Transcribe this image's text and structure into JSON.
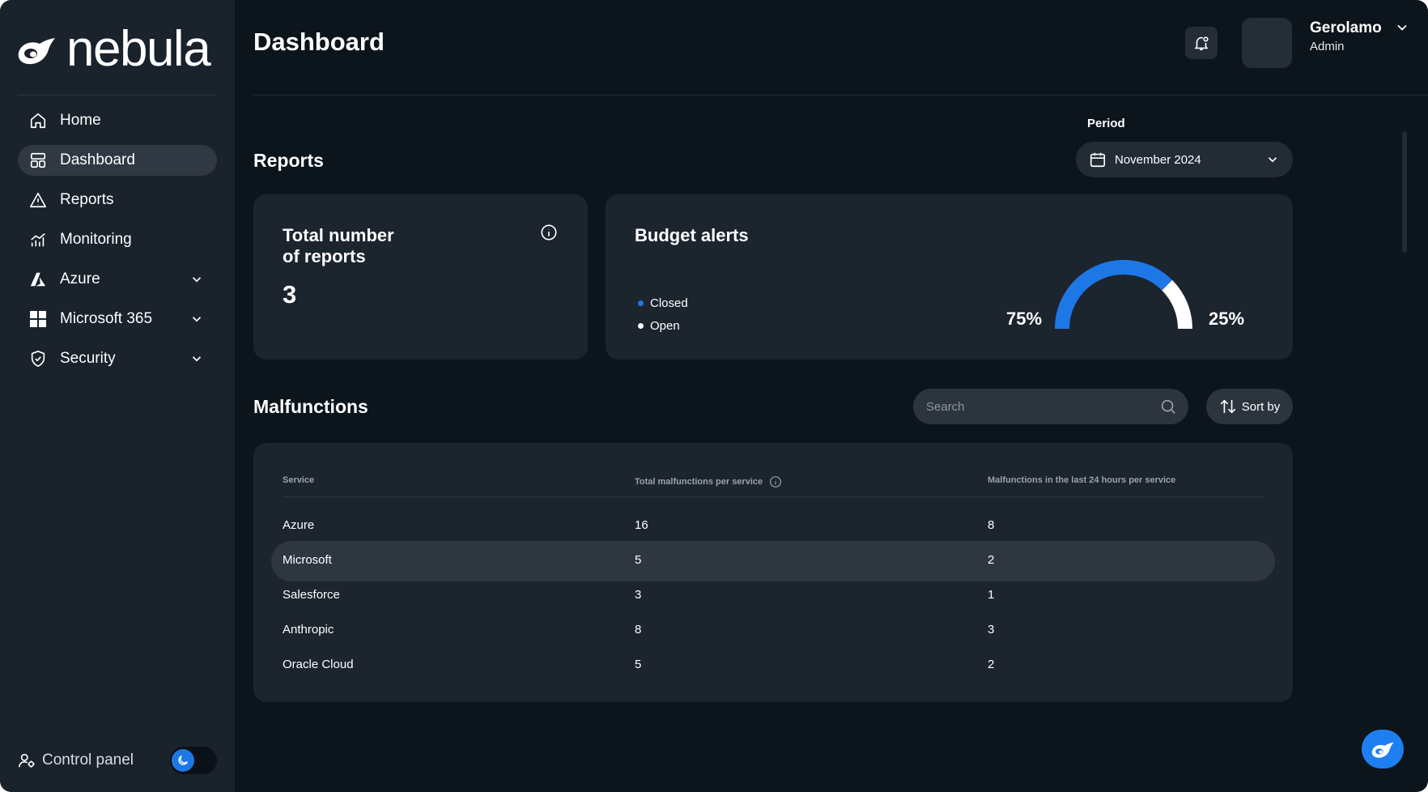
{
  "app": {
    "brand": "nebula"
  },
  "sidebar": {
    "items": [
      {
        "label": "Home",
        "icon": "home-icon"
      },
      {
        "label": "Dashboard",
        "icon": "dashboard-icon",
        "active": true
      },
      {
        "label": "Reports",
        "icon": "warning-icon"
      },
      {
        "label": "Monitoring",
        "icon": "chart-icon"
      },
      {
        "label": "Azure",
        "icon": "azure-icon",
        "expandable": true
      },
      {
        "label": "Microsoft 365",
        "icon": "windows-icon",
        "expandable": true
      },
      {
        "label": "Security",
        "icon": "shield-icon",
        "expandable": true
      }
    ],
    "control_panel": {
      "label": "Control panel",
      "dark_mode": true
    }
  },
  "header": {
    "title": "Dashboard",
    "user": {
      "name": "Gerolamo",
      "role": "Admin"
    }
  },
  "reports": {
    "section_title": "Reports",
    "period_label": "Period",
    "period_value": "November 2024",
    "total_card": {
      "title_line1": "Total number",
      "title_line2": "of reports",
      "value": "3"
    },
    "budget_card": {
      "title": "Budget alerts",
      "legend": [
        {
          "label": "Closed",
          "color": "#1d78e6"
        },
        {
          "label": "Open",
          "color": "#ffffff"
        }
      ],
      "closed_pct_label": "75%",
      "open_pct_label": "25%",
      "closed_fraction": 0.75
    }
  },
  "malfunctions": {
    "section_title": "Malfunctions",
    "search_placeholder": "Search",
    "sort_label": "Sort by",
    "columns": [
      "Service",
      "Total malfunctions per service",
      "Malfunctions in the last 24 hours per service"
    ],
    "rows": [
      {
        "service": "Azure",
        "total": "16",
        "last24": "8"
      },
      {
        "service": "Microsoft",
        "total": "5",
        "last24": "2",
        "highlighted": true
      },
      {
        "service": "Salesforce",
        "total": "3",
        "last24": "1"
      },
      {
        "service": "Anthropic",
        "total": "8",
        "last24": "3"
      },
      {
        "service": "Oracle Cloud",
        "total": "5",
        "last24": "2"
      }
    ]
  },
  "colors": {
    "accent": "#1d78e6",
    "background": "#0c141c",
    "sidebar": "#1a222c",
    "card": "#1c242e"
  }
}
